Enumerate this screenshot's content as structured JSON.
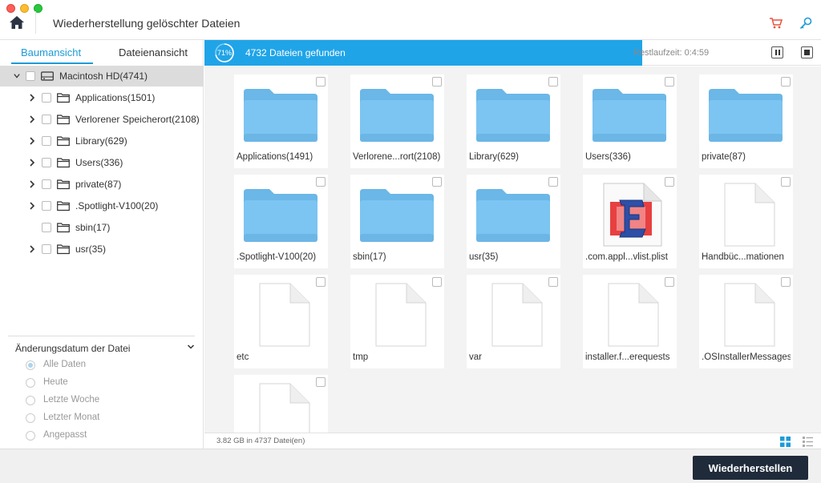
{
  "window": {
    "title": "Wiederherstellung gelöschter Dateien"
  },
  "icons": {
    "home": "home-icon",
    "cart": "cart-icon",
    "key": "key-icon"
  },
  "colors": {
    "accent": "#1d9bd8",
    "progress": "#20a4e8",
    "cart": "#e8533f",
    "key": "#1d9bd8",
    "button": "#1f2b3a"
  },
  "tabs": [
    {
      "label": "Baumansicht",
      "active": true
    },
    {
      "label": "Dateienansicht",
      "active": false
    }
  ],
  "tree": {
    "root": {
      "label": "Macintosh HD(4741)"
    },
    "items": [
      {
        "label": "Applications(1501)",
        "has_children": true
      },
      {
        "label": "Verlorener Speicherort(2108)",
        "has_children": true
      },
      {
        "label": "Library(629)",
        "has_children": true
      },
      {
        "label": "Users(336)",
        "has_children": true
      },
      {
        "label": "private(87)",
        "has_children": true
      },
      {
        "label": ".Spotlight-V100(20)",
        "has_children": true
      },
      {
        "label": "sbin(17)",
        "has_children": false
      },
      {
        "label": "usr(35)",
        "has_children": true
      }
    ]
  },
  "filter": {
    "title": "Änderungsdatum der Datei",
    "options": [
      {
        "label": "Alle Daten",
        "checked": true
      },
      {
        "label": "Heute",
        "checked": false
      },
      {
        "label": "Letzte Woche",
        "checked": false
      },
      {
        "label": "Letzter Monat",
        "checked": false
      },
      {
        "label": "Angepasst",
        "checked": false
      }
    ]
  },
  "progress": {
    "percent": 71,
    "percent_label": "71%",
    "found_text": "4732 Dateien gefunden",
    "remaining_text": "Restlaufzeit: 0:4:59"
  },
  "files": [
    {
      "label": "Applications(1491)",
      "type": "folder"
    },
    {
      "label": "Verlorene...rort(2108)",
      "type": "folder"
    },
    {
      "label": "Library(629)",
      "type": "folder"
    },
    {
      "label": "Users(336)",
      "type": "folder"
    },
    {
      "label": "private(87)",
      "type": "folder"
    },
    {
      "label": ".Spotlight-V100(20)",
      "type": "folder"
    },
    {
      "label": "sbin(17)",
      "type": "folder"
    },
    {
      "label": "usr(35)",
      "type": "folder"
    },
    {
      "label": ".com.appl...vlist.plist",
      "type": "plist"
    },
    {
      "label": "Handbüc...mationen",
      "type": "file"
    },
    {
      "label": "etc",
      "type": "file"
    },
    {
      "label": "tmp",
      "type": "file"
    },
    {
      "label": "var",
      "type": "file"
    },
    {
      "label": "installer.f...erequests",
      "type": "file"
    },
    {
      "label": ".OSInstallerMessages",
      "type": "file"
    },
    {
      "label": "",
      "type": "file"
    }
  ],
  "status": {
    "summary": "3.82 GB in 4737 Datei(en)"
  },
  "footer": {
    "recover_label": "Wiederherstellen"
  }
}
